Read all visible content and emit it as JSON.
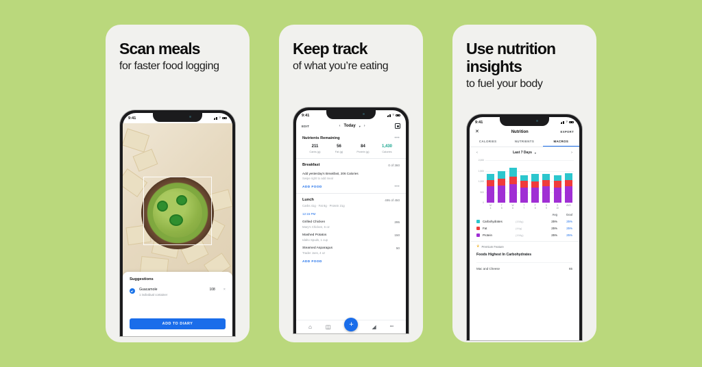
{
  "background_color": "#bad87c",
  "cards": [
    {
      "title": "Scan meals",
      "subtitle": "for faster food logging",
      "phone": {
        "status": {
          "time": "9:41"
        },
        "photo_alt": "guacamole-bowl-with-tortilla-chips",
        "sheet": {
          "heading": "Suggestions",
          "item_name": "Guacamole",
          "item_desc": "1 individual container",
          "item_calories": "108",
          "remove_label": "×",
          "cta": "ADD TO DIARY"
        }
      }
    },
    {
      "title": "Keep track",
      "subtitle": "of what you’re eating",
      "phone": {
        "status": {
          "time": "9:41"
        },
        "nav": {
          "edit": "EDIT",
          "date": "Today",
          "prev": "‹",
          "next": "›",
          "caret": "▾"
        },
        "nutrients": {
          "heading": "Nutrients Remaining",
          "more": "•••",
          "items": [
            {
              "value": "211",
              "label": "Carbs (g)"
            },
            {
              "value": "56",
              "label": "Fat (g)"
            },
            {
              "value": "84",
              "label": "Protein (g)"
            },
            {
              "value": "1,430",
              "label": "Calories"
            }
          ]
        },
        "meals": [
          {
            "name": "Breakfast",
            "count": "0 of 360",
            "suggest": "Add yesterday’s Breakfast, 206 Calories",
            "swipe": "Swipe right to add meal",
            "add": "ADD FOOD"
          },
          {
            "name": "Lunch",
            "count": "495 of 450",
            "macros": "Carbs 41g  ·  Fat 8g  ·  Protein 21g",
            "time": "12:15 PM",
            "add": "ADD FOOD",
            "foods": [
              {
                "name": "Grilled Chicken",
                "brand": "Mary’s Chicken, 6 oz",
                "calories": "295"
              },
              {
                "name": "Mashed Potatos",
                "brand": "Idaho Spuds, 1 cup",
                "calories": "150"
              },
              {
                "name": "Steamed Asparagus",
                "brand": "Trader Joes, 4 oz",
                "calories": "50"
              }
            ]
          }
        ],
        "tabbar": {
          "home": "⌂",
          "diary": "◫",
          "add": "+",
          "progress": "◢",
          "more": "•••"
        }
      }
    },
    {
      "title": "Use nutrition insights",
      "subtitle": "to fuel your body",
      "phone": {
        "status": {
          "time": "9:41"
        },
        "nav": {
          "close": "✕",
          "title": "Nutrition",
          "export": "EXPORT"
        },
        "tabs": [
          {
            "label": "CALORIES",
            "active": false
          },
          {
            "label": "NUTRIENTS",
            "active": false
          },
          {
            "label": "MACROS",
            "active": true
          }
        ],
        "range": {
          "prev": "‹",
          "label": "Last 7 Days",
          "caret": "▾",
          "next": "›"
        },
        "legend": {
          "col_avg": "Avg",
          "col_goal": "Goal",
          "rows": [
            {
              "name": "Carbohydrates",
              "grams": "(158g)",
              "avg": "25%",
              "goal": "25%",
              "color": "#2cc6cd"
            },
            {
              "name": "Fat",
              "grams": "(44g)",
              "avg": "25%",
              "goal": "25%",
              "color": "#ef3b3b"
            },
            {
              "name": "Protein",
              "grams": "(158g)",
              "avg": "25%",
              "goal": "25%",
              "color": "#a02fd4"
            }
          ]
        },
        "premium": {
          "badge": "Premium Feature",
          "crown": "♛",
          "title": "Foods Highest In Carbohydrates",
          "item_name": "Mac and Cheese",
          "item_value": "65"
        }
      }
    }
  ],
  "chart_data": {
    "type": "bar",
    "stacked": true,
    "title": "Macros — Last 7 Days",
    "xlabel": "",
    "ylabel": "",
    "ylim": [
      0,
      2000
    ],
    "yticks": [
      "0",
      "500",
      "1,000",
      "1,500",
      "2,000"
    ],
    "grid": true,
    "legend_position": "below",
    "categories": [
      "M",
      "T",
      "W",
      "T",
      "F",
      "S",
      "S",
      "AVG"
    ],
    "tick_sublabels": [
      "4",
      "5",
      "6",
      "7",
      "8",
      "9",
      "10",
      ""
    ],
    "series": [
      {
        "name": "Protein",
        "color": "#a02fd4",
        "values": [
          760,
          800,
          880,
          720,
          700,
          760,
          720,
          760
        ]
      },
      {
        "name": "Fat",
        "color": "#ef3b3b",
        "values": [
          300,
          340,
          360,
          320,
          310,
          300,
          320,
          320
        ]
      },
      {
        "name": "Carbohydrates",
        "color": "#2cc6cd",
        "values": [
          300,
          330,
          420,
          260,
          330,
          280,
          260,
          310
        ]
      }
    ]
  }
}
